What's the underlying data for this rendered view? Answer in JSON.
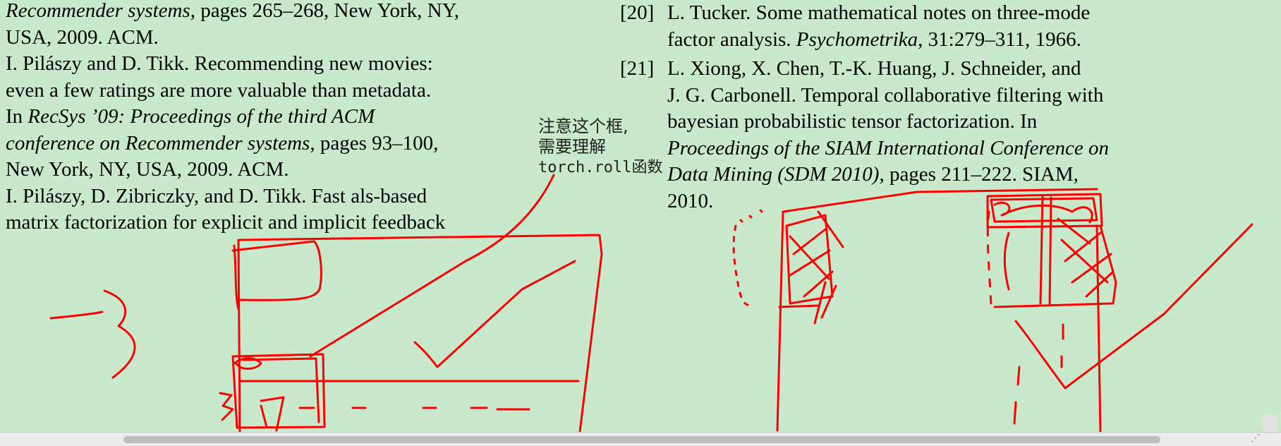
{
  "left_refs": {
    "l1_italic": "Recommender systems",
    "l1_rest": ", pages 265–268, New York, NY,",
    "l2": "USA, 2009. ACM.",
    "l3": "I. Pilászy and D. Tikk. Recommending new movies:",
    "l4": "even a few ratings are more valuable than metadata.",
    "l5_pre": "In ",
    "l5_italic": "RecSys ’09: Proceedings of the third ACM",
    "l6_italic": "conference on Recommender systems",
    "l6_rest": ", pages 93–100,",
    "l7": "New York, NY, USA, 2009. ACM.",
    "l8": "I. Pilászy, D. Zibriczky, and D. Tikk. Fast als-based",
    "l9": "matrix factorization for explicit and implicit feedback"
  },
  "right_refs": [
    {
      "num": "[20]",
      "line1": "L. Tucker. Some mathematical notes on three-mode",
      "line2_pre": "factor analysis. ",
      "line2_italic": "Psychometrika",
      "line2_rest": ", 31:279–311, 1966."
    },
    {
      "num": "[21]",
      "line1": "L. Xiong, X. Chen, T.-K. Huang, J. Schneider, and",
      "line2": "J. G. Carbonell. Temporal collaborative filtering with",
      "line3": "bayesian probabilistic tensor factorization. In",
      "line4_italic": "Proceedings of the SIAM International Conference on",
      "line5_italic": "Data Mining (SDM 2010)",
      "line5_rest": ", pages 211–222. SIAM,",
      "line6": "2010."
    }
  ],
  "annotation": {
    "line1": "注意这个框,",
    "line2": "需要理解",
    "line3": "torch.roll函数"
  },
  "colors": {
    "background": "#c9e9cc",
    "ink": "#ff0000",
    "scrollbar": "#bdbdbd"
  },
  "icons": {
    "resize": "resize-grip-icon"
  }
}
